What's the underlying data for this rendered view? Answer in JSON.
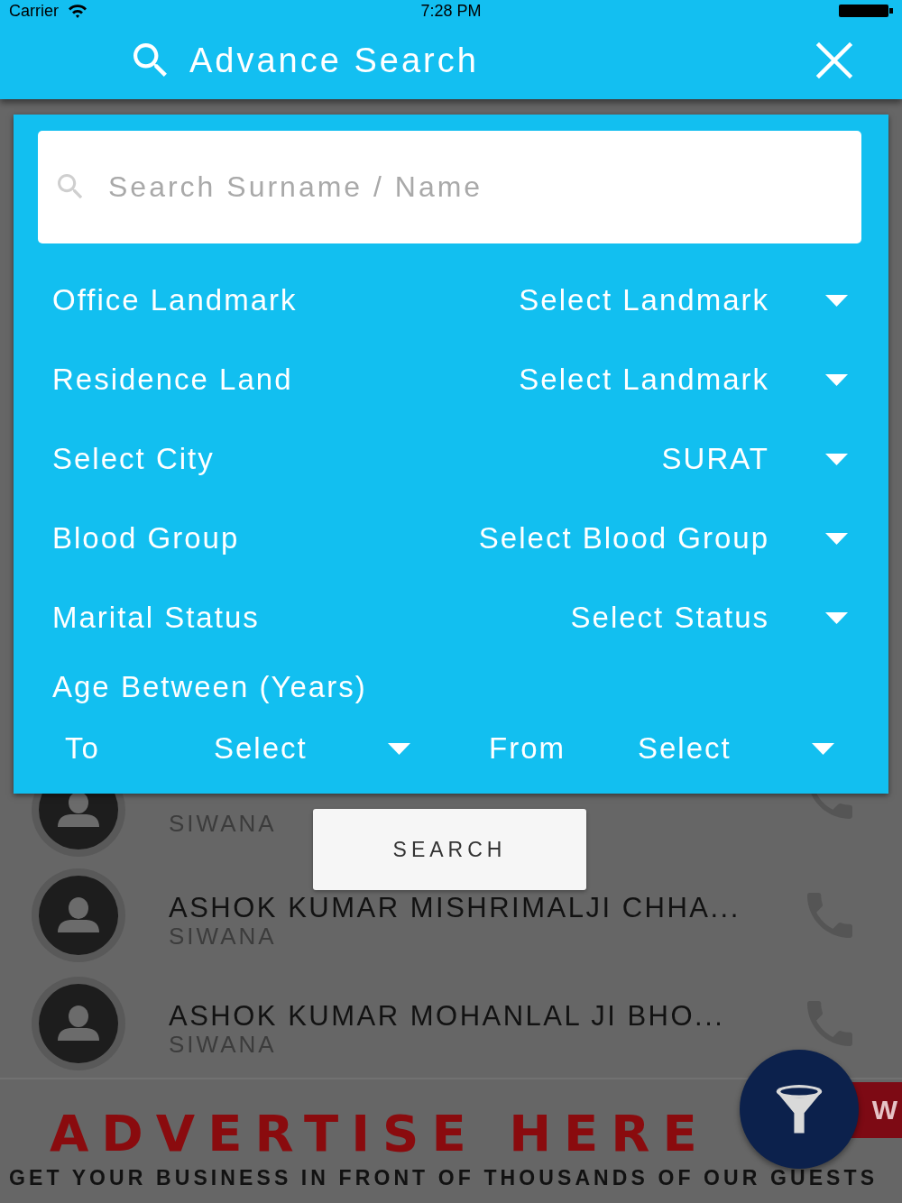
{
  "status_bar": {
    "carrier": "Carrier",
    "time": "7:28 PM"
  },
  "header": {
    "title": "Advance Search"
  },
  "search": {
    "placeholder": "Search Surname / Name"
  },
  "filters": [
    {
      "label": "Office Landmark",
      "value": "Select Landmark"
    },
    {
      "label": "Residence Land",
      "value": "Select Landmark"
    },
    {
      "label": "Select City",
      "value": "SURAT"
    },
    {
      "label": "Blood Group",
      "value": "Select Blood Group"
    },
    {
      "label": "Marital Status",
      "value": "Select Status"
    }
  ],
  "age_range": {
    "label": "Age Between (Years)",
    "bounds": [
      {
        "label": "To",
        "value": "Select"
      },
      {
        "label": "From",
        "value": "Select"
      }
    ]
  },
  "search_button": {
    "label": "SEARCH"
  },
  "contacts": [
    {
      "kind": "partial",
      "place": "SIWANA"
    },
    {
      "kind": "full",
      "name": "ASHOK KUMAR MISHRIMALJI CHHA...",
      "place": "SIWANA"
    },
    {
      "kind": "full",
      "name": "ASHOK KUMAR MOHANLAL JI BHO...",
      "place": "SIWANA"
    }
  ],
  "advert": {
    "headline": "ADVERTISE HERE",
    "ribbon": "W",
    "tagline": "GET YOUR BUSINESS IN FRONT OF THOUSANDS OF OUR GUESTS"
  }
}
